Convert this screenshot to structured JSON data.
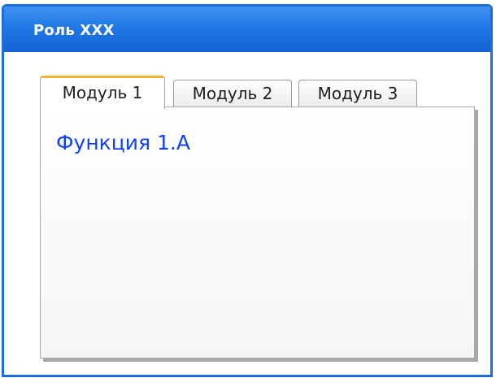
{
  "window": {
    "title": "Роль XXX",
    "border_color": "#1a6fd8",
    "title_color": "#ffffff"
  },
  "tabs": [
    {
      "label": "Модуль 1",
      "active": true
    },
    {
      "label": "Модуль 2",
      "active": false
    },
    {
      "label": "Модуль 3",
      "active": false
    }
  ],
  "panel": {
    "function_label": "Функция 1.А",
    "link_color": "#1040f0"
  },
  "colors": {
    "active_tab_accent": "#f2b433",
    "title_bar": "#2079e6"
  }
}
